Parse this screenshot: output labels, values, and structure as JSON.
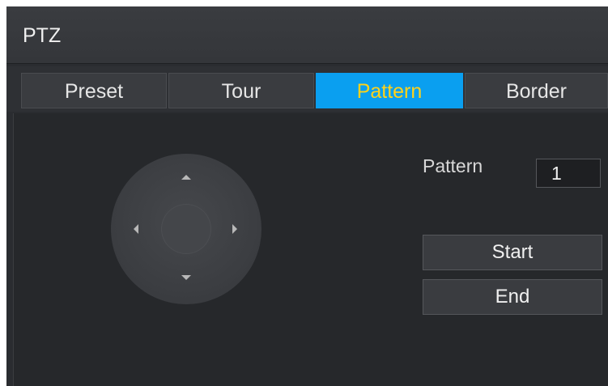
{
  "window": {
    "title": "PTZ"
  },
  "tabs": [
    {
      "label": "Preset",
      "active": false
    },
    {
      "label": "Tour",
      "active": false
    },
    {
      "label": "Pattern",
      "active": true
    },
    {
      "label": "Border",
      "active": false
    }
  ],
  "pattern": {
    "label": "Pattern",
    "value": "1"
  },
  "buttons": {
    "start": "Start",
    "end": "End"
  },
  "colors": {
    "active_tab_bg": "#0a9ff0",
    "active_tab_text": "#ffd21a"
  }
}
